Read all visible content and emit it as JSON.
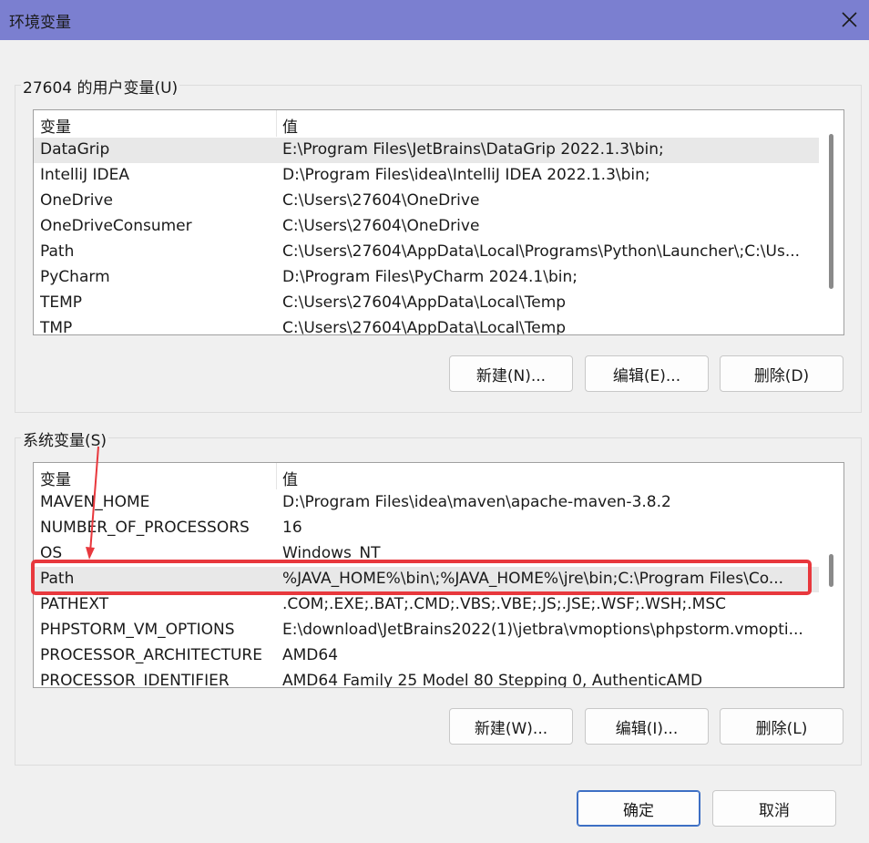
{
  "window": {
    "title": "环境变量",
    "close_icon": "close-icon"
  },
  "user_vars": {
    "legend": "27604 的用户变量(U)",
    "columns": [
      "变量",
      "值"
    ],
    "rows": [
      {
        "name": "DataGrip",
        "value": "E:\\Program Files\\JetBrains\\DataGrip 2022.1.3\\bin;"
      },
      {
        "name": "IntelliJ IDEA",
        "value": "D:\\Program Files\\idea\\IntelliJ IDEA 2022.1.3\\bin;"
      },
      {
        "name": "OneDrive",
        "value": "C:\\Users\\27604\\OneDrive"
      },
      {
        "name": "OneDriveConsumer",
        "value": "C:\\Users\\27604\\OneDrive"
      },
      {
        "name": "Path",
        "value": "C:\\Users\\27604\\AppData\\Local\\Programs\\Python\\Launcher\\;C:\\Us..."
      },
      {
        "name": "PyCharm",
        "value": "D:\\Program Files\\PyCharm 2024.1\\bin;"
      },
      {
        "name": "TEMP",
        "value": "C:\\Users\\27604\\AppData\\Local\\Temp"
      },
      {
        "name": "TMP",
        "value": "C:\\Users\\27604\\AppData\\Local\\Temp"
      }
    ],
    "buttons": {
      "new": "新建(N)...",
      "edit": "编辑(E)...",
      "delete": "删除(D)"
    }
  },
  "system_vars": {
    "legend": "系统变量(S)",
    "columns": [
      "变量",
      "值"
    ],
    "rows": [
      {
        "name": "MAVEN_HOME",
        "value": "D:\\Program Files\\idea\\maven\\apache-maven-3.8.2"
      },
      {
        "name": "NUMBER_OF_PROCESSORS",
        "value": "16"
      },
      {
        "name": "OS",
        "value": "Windows_NT"
      },
      {
        "name": "Path",
        "value": "%JAVA_HOME%\\bin\\;%JAVA_HOME%\\jre\\bin;C:\\Program Files\\Co..."
      },
      {
        "name": "PATHEXT",
        "value": ".COM;.EXE;.BAT;.CMD;.VBS;.VBE;.JS;.JSE;.WSF;.WSH;.MSC"
      },
      {
        "name": "PHPSTORM_VM_OPTIONS",
        "value": "E:\\download\\JetBrains2022(1)\\jetbra\\vmoptions\\phpstorm.vmopti..."
      },
      {
        "name": "PROCESSOR_ARCHITECTURE",
        "value": "AMD64"
      },
      {
        "name": "PROCESSOR_IDENTIFIER",
        "value": "AMD64 Family 25 Model 80 Stepping 0, AuthenticAMD"
      }
    ],
    "buttons": {
      "new": "新建(W)...",
      "edit": "编辑(I)...",
      "delete": "删除(L)"
    }
  },
  "dialog_buttons": {
    "ok": "确定",
    "cancel": "取消"
  },
  "colors": {
    "titlebar": "#7b7fd0",
    "highlight": "#e8383d",
    "primary_border": "#3d6fc4"
  }
}
